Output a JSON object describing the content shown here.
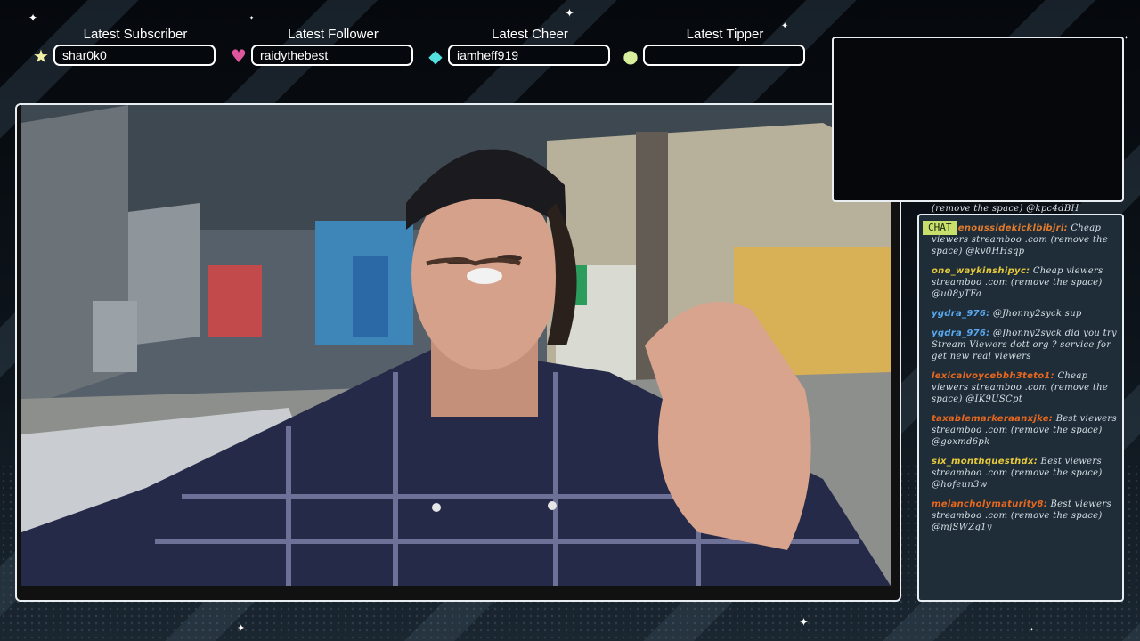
{
  "alerts": [
    {
      "title": "Latest Subscriber",
      "value": "shar0k0",
      "icon": "star-icon",
      "icon_glyph": "★",
      "color": "#f2f0a6"
    },
    {
      "title": "Latest Follower",
      "value": "raidythebest",
      "icon": "heart-icon",
      "icon_glyph": "♥",
      "color": "#e0569d"
    },
    {
      "title": "Latest Cheer",
      "value": "iamheff919",
      "icon": "gem-icon",
      "icon_glyph": "◆",
      "color": "#52e0e0"
    },
    {
      "title": "Latest Tipper",
      "value": "",
      "icon": "coin-icon",
      "icon_glyph": "●",
      "color": "#d8ee9c"
    }
  ],
  "chat": {
    "tag": "CHAT",
    "messages": [
      {
        "user": "",
        "text": "(remove the space) @kpc4dBH",
        "color": "#d7e1e7"
      },
      {
        "user": "indigenoussidekicklbibjri:",
        "text": "Cheap viewers streamboo .com (remove the space) @kv0HHsqp",
        "color": "#e07a2e"
      },
      {
        "user": "one_waykinshipyc:",
        "text": "Cheap viewers streamboo .com (remove the space) @u08yTFa",
        "color": "#e6c93a"
      },
      {
        "user": "ygdra_976:",
        "text": "@Jhonny2syck sup",
        "color": "#5aa9f0"
      },
      {
        "user": "ygdra_976:",
        "text": "@Jhonny2syck did you try Stream Viewers dott org ? service for get new real viewers",
        "color": "#5aa9f0"
      },
      {
        "user": "lexicalvoycebbh3teto1:",
        "text": "Cheap viewers streamboo .com (remove the space) @IK9USCpt",
        "color": "#e8671f"
      },
      {
        "user": "taxablemarkeraanxjke:",
        "text": "Best viewers streamboo .com (remove the space) @goxmd6pk",
        "color": "#e8671f"
      },
      {
        "user": "six_monthquesthdx:",
        "text": "Best viewers streamboo .com (remove the space) @hofeun3w",
        "color": "#e6c93a"
      },
      {
        "user": "melancholymaturity8:",
        "text": "Best viewers streamboo .com (remove the space) @mjSWZq1y",
        "color": "#e8671f"
      }
    ]
  }
}
